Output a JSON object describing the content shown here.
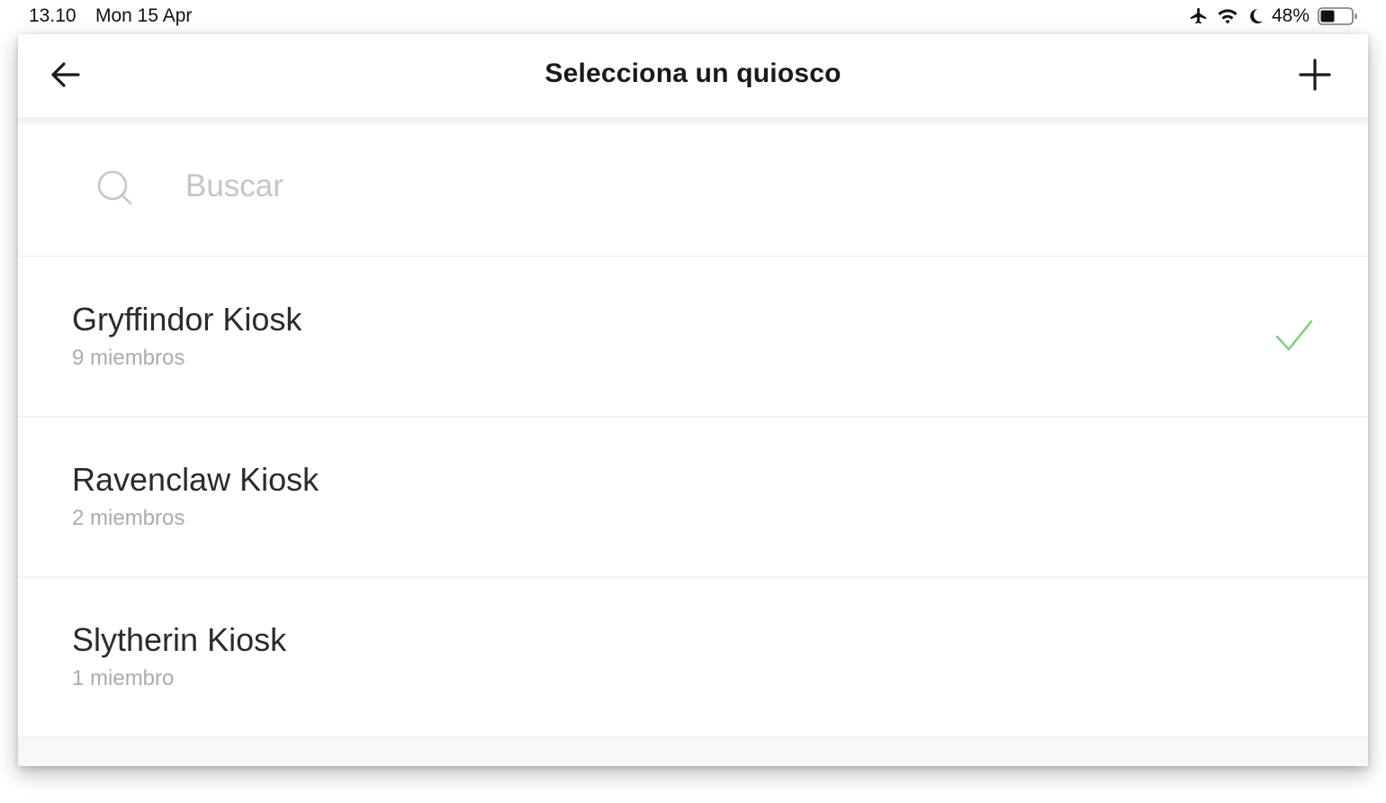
{
  "status_bar": {
    "time": "13.10",
    "date": "Mon 15 Apr",
    "battery": "48%",
    "icons": [
      "airplane-icon",
      "wifi-icon",
      "moon-icon",
      "battery-icon"
    ]
  },
  "navbar": {
    "title": "Selecciona un quiosco",
    "back_icon": "arrow-left-icon",
    "add_icon": "plus-icon"
  },
  "search": {
    "placeholder": "Buscar",
    "value": "",
    "icon": "search-icon"
  },
  "kiosks": [
    {
      "name": "Gryffindor Kiosk",
      "members": "9 miembros",
      "selected": true
    },
    {
      "name": "Ravenclaw Kiosk",
      "members": "2 miembros",
      "selected": false
    },
    {
      "name": "Slytherin Kiosk",
      "members": "1 miembro",
      "selected": false
    }
  ],
  "colors": {
    "check": "#7ccf7c",
    "text_primary": "#2b2b2b",
    "text_secondary": "#a9acb2",
    "placeholder": "#c3c6cc"
  }
}
